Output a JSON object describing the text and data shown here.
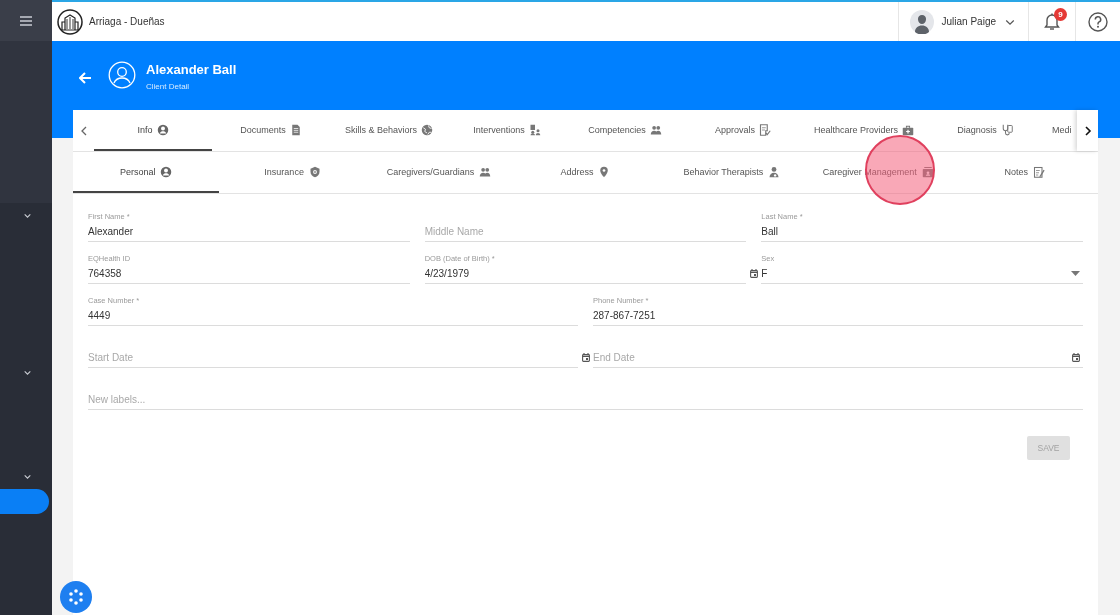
{
  "sidebar": {
    "sections": [
      {
        "expanded": false
      },
      {
        "expanded": false
      },
      {
        "expanded": false
      }
    ],
    "items": [
      {
        "selected": true
      }
    ]
  },
  "topbar": {
    "organization": "Arriaga - Dueñas",
    "user": "Julian Paige",
    "notifications": "9"
  },
  "header": {
    "title": "Alexander Ball",
    "subtitle": "Client Detail"
  },
  "tabs": [
    {
      "label": "Info",
      "selected": true
    },
    {
      "label": "Documents",
      "selected": false
    },
    {
      "label": "Skills & Behaviors",
      "selected": false
    },
    {
      "label": "Interventions",
      "selected": false
    },
    {
      "label": "Competencies",
      "selected": false
    },
    {
      "label": "Approvals",
      "selected": false
    },
    {
      "label": "Healthcare Providers",
      "selected": false
    },
    {
      "label": "Diagnosis",
      "selected": false
    },
    {
      "label": "Medi",
      "selected": false
    }
  ],
  "subtabs": [
    {
      "label": "Personal",
      "selected": true
    },
    {
      "label": "Insurance",
      "selected": false
    },
    {
      "label": "Caregivers/Guardians",
      "selected": false
    },
    {
      "label": "Address",
      "selected": false
    },
    {
      "label": "Behavior Therapists",
      "selected": false
    },
    {
      "label": "Caregiver Management",
      "selected": false
    },
    {
      "label": "Notes",
      "selected": false
    }
  ],
  "form": {
    "rows": [
      [
        {
          "kind": "text",
          "label": "First Name *",
          "value": "Alexander"
        },
        {
          "kind": "text",
          "placeholder": "Middle Name"
        },
        {
          "kind": "text",
          "label": "Last Name *",
          "value": "Ball"
        }
      ],
      [
        {
          "kind": "text",
          "label": "EQHealth ID",
          "value": "764358"
        },
        {
          "kind": "date",
          "label": "DOB (Date of Birth) *",
          "value": "4/23/1979"
        },
        {
          "kind": "select",
          "label": "Sex",
          "value": "F"
        }
      ],
      [
        {
          "kind": "text",
          "label": "Case Number *",
          "value": "4449"
        },
        {
          "kind": "text",
          "label": "Phone Number *",
          "value": "287-867-7251"
        }
      ],
      [
        {
          "kind": "date",
          "placeholder": "Start Date"
        },
        {
          "kind": "date",
          "placeholder": "End Date"
        }
      ],
      [
        {
          "kind": "text",
          "placeholder": "New labels..."
        }
      ]
    ],
    "save_button": {
      "label": "SAVE",
      "disabled": true
    }
  }
}
